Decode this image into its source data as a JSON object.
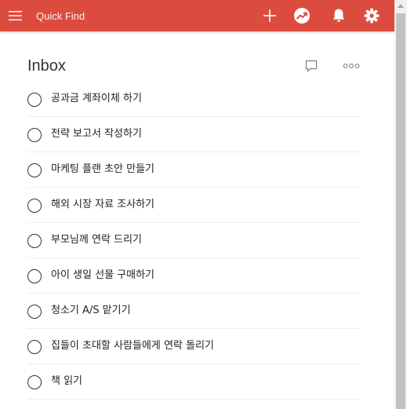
{
  "colors": {
    "accent": "#db4c3f",
    "text": "#222222",
    "divider": "#eeeeee"
  },
  "topbar": {
    "menu_icon": "hamburger-menu-icon",
    "search": {
      "placeholder": "Quick Find",
      "value": ""
    },
    "add_icon": "plus-icon",
    "karma_icon": "productivity-trend-icon",
    "notifications_icon": "bell-icon",
    "settings_icon": "gear-icon"
  },
  "project": {
    "title": "Inbox",
    "comment_icon": "comment-icon",
    "more_icon": "more-horizontal-icon"
  },
  "tasks": [
    {
      "text": "공과금 계좌이체 하기"
    },
    {
      "text": "전략 보고서 작성하기"
    },
    {
      "text": "마케팅 플랜 초안 만들기"
    },
    {
      "text": "해외 시장 자료 조사하기"
    },
    {
      "text": "부모님께 연락 드리기"
    },
    {
      "text": "아이 생일 선물 구매하기"
    },
    {
      "text": "청소기 A/S 맡기기"
    },
    {
      "text": "집들이 초대할 사람들에게 연락 돌리기"
    },
    {
      "text": "책 읽기"
    }
  ]
}
